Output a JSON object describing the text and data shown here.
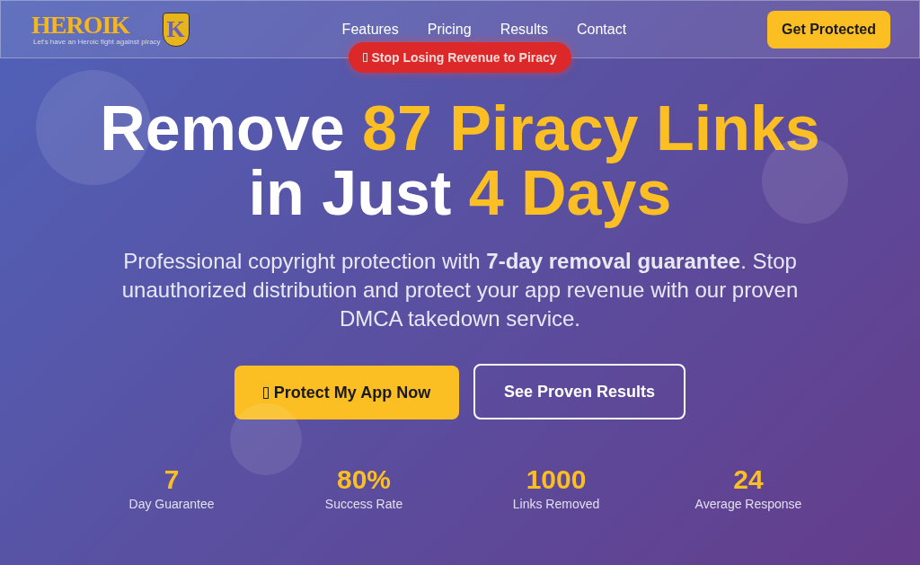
{
  "logo": {
    "wordmark": "HEROIK",
    "badge_letter": "K",
    "tagline": "Let's have an Heroic fight against piracy"
  },
  "nav": {
    "links": [
      "Features",
      "Pricing",
      "Results",
      "Contact"
    ],
    "cta": "Get Protected"
  },
  "banner": {
    "label": "Stop Losing Revenue to Piracy"
  },
  "headline": {
    "lines": [
      [
        {
          "text": "Remove ",
          "highlight": false
        },
        {
          "text": "87 Piracy Links",
          "highlight": true
        }
      ],
      [
        {
          "text": "in Just ",
          "highlight": false
        },
        {
          "text": "4 Days",
          "highlight": true
        }
      ]
    ]
  },
  "subtitle": "Professional copyright protection with **7-day removal guarantee**. Stop unauthorized distribution and protect your app revenue with our proven DMCA takedown service.",
  "buttons": [
    {
      "label": "Protect My App Now",
      "kind": "primary"
    },
    {
      "label": "See Proven Results",
      "kind": "outline"
    }
  ],
  "stats": [
    {
      "value": "7",
      "label": "Day Guarantee"
    },
    {
      "value": "80%",
      "label": "Success Rate"
    },
    {
      "value": "1000",
      "label": "Links Removed"
    },
    {
      "value": "24",
      "label": "Average Response"
    }
  ]
}
